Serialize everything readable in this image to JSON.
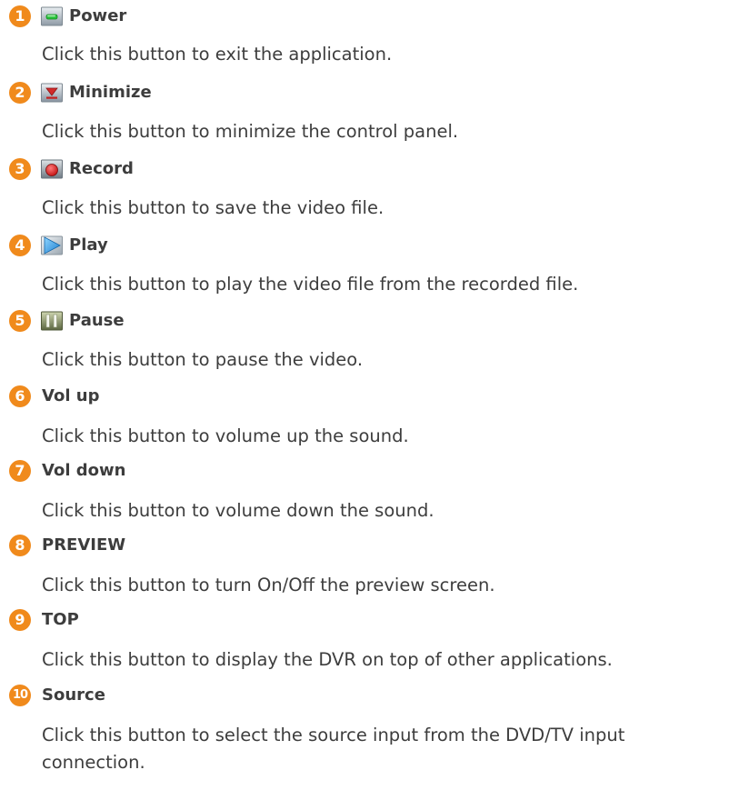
{
  "items": [
    {
      "num": "1",
      "title": "Power",
      "icon": "power-icon",
      "desc": "Click this button to exit the application."
    },
    {
      "num": "2",
      "title": "Minimize",
      "icon": "minimize-icon",
      "desc": "Click this button to minimize the control panel."
    },
    {
      "num": "3",
      "title": "Record",
      "icon": "record-icon",
      "desc": "Click this button to save the video file."
    },
    {
      "num": "4",
      "title": "Play",
      "icon": "play-icon",
      "desc": "Click this button to play the video file from the recorded file."
    },
    {
      "num": "5",
      "title": "Pause",
      "icon": "pause-icon",
      "desc": "Click this button to pause the video."
    },
    {
      "num": "6",
      "title": "Vol up",
      "desc": "Click this button to volume up the sound."
    },
    {
      "num": "7",
      "title": "Vol down",
      "desc": "Click this button to volume down the sound."
    },
    {
      "num": "8",
      "title": "PREVIEW",
      "desc": "Click this button to turn On/Off the preview screen."
    },
    {
      "num": "9",
      "title": "TOP",
      "desc": "Click this button to display the DVR on top of other applications."
    },
    {
      "num": "10",
      "title": "Source",
      "desc": "Click this button to select the source input from the DVD/TV input connection."
    }
  ],
  "colors": {
    "badge": "#f08a1c",
    "text": "#3d3d3d"
  }
}
